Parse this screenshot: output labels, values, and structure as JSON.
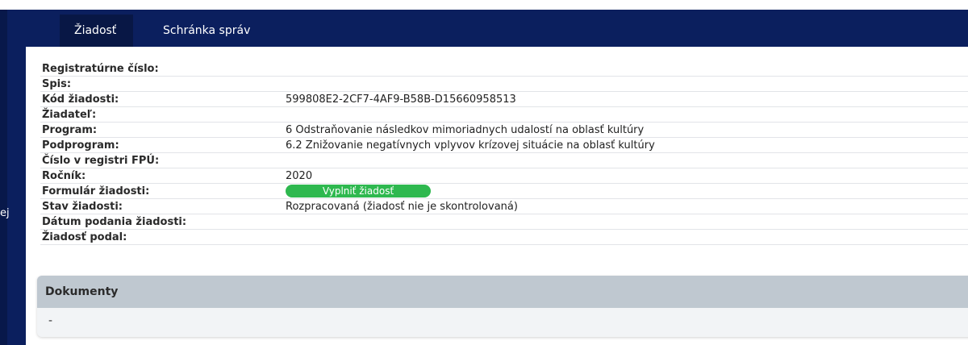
{
  "sidebar": {
    "partial_label": "ej"
  },
  "tabs": [
    {
      "label": "Žiadosť",
      "active": true
    },
    {
      "label": "Schránka správ",
      "active": false
    }
  ],
  "fields": [
    {
      "label": "Registratúrne číslo:",
      "value": ""
    },
    {
      "label": "Spis:",
      "value": ""
    },
    {
      "label": "Kód žiadosti:",
      "value": "599808E2-2CF7-4AF9-B58B-D15660958513"
    },
    {
      "label": "Žiadateľ:",
      "value": ""
    },
    {
      "label": "Program:",
      "value": "6 Odstraňovanie následkov mimoriadnych udalostí na oblasť kultúry"
    },
    {
      "label": "Podprogram:",
      "value": "6.2 Znižovanie negatívnych vplyvov krízovej situácie na oblasť kultúry"
    },
    {
      "label": "Číslo v registri FPÚ:",
      "value": ""
    },
    {
      "label": "Ročník:",
      "value": "2020"
    },
    {
      "label": "Formulár žiadosti:",
      "button_label": "Vyplniť žiadosť"
    },
    {
      "label": "Stav žiadosti:",
      "value": "Rozpracovaná (žiadosť nie je skontrolovaná)"
    },
    {
      "label": "Dátum podania žiadosti:",
      "value": ""
    },
    {
      "label": "Žiadosť podal:",
      "value": ""
    }
  ],
  "documents": {
    "title": "Dokumenty",
    "empty_text": "-"
  },
  "colors": {
    "nav": "#0b1f5e",
    "active_tab": "#081745",
    "button": "#2eb84f",
    "panel_header": "#bfc8d0"
  }
}
